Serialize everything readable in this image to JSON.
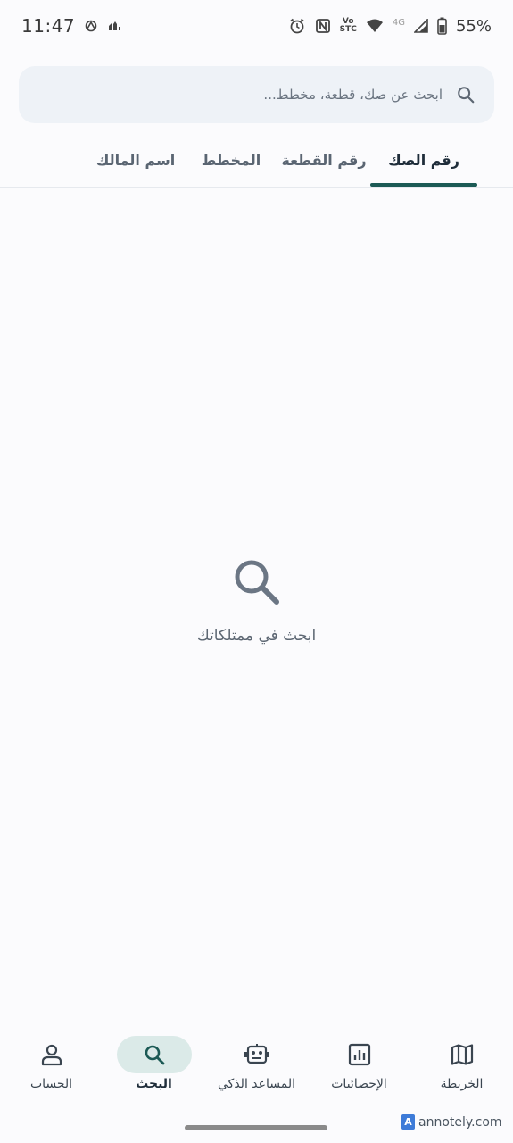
{
  "status_bar": {
    "time": "11:47",
    "battery_percent": "55%",
    "network": "4G",
    "carrier_top": "Vo",
    "carrier_bottom": "STC",
    "icons": [
      "android-auto-icon",
      "app-notification-icon",
      "alarm-icon",
      "nfc-icon",
      "wifi-icon",
      "signal-icon",
      "battery-icon"
    ]
  },
  "search": {
    "placeholder": "ابحث عن صك، قطعة، مخطط...",
    "value": ""
  },
  "tabs": [
    {
      "label": "رقم الصك",
      "active": true
    },
    {
      "label": "رقم القطعة",
      "active": false
    },
    {
      "label": "المخطط",
      "active": false
    },
    {
      "label": "اسم المالك",
      "active": false
    }
  ],
  "empty_state": {
    "message": "ابحث في ممتلكاتك"
  },
  "bottom_nav": [
    {
      "label": "الخريطة",
      "icon": "map-icon",
      "active": false
    },
    {
      "label": "الإحصائيات",
      "icon": "statistics-icon",
      "active": false
    },
    {
      "label": "المساعد الذكي",
      "icon": "robot-icon",
      "active": false
    },
    {
      "label": "البحث",
      "icon": "search-icon",
      "active": true
    },
    {
      "label": "الحساب",
      "icon": "account-icon",
      "active": false
    }
  ],
  "watermark": {
    "logo": "A",
    "text": "annotely.com"
  },
  "colors": {
    "accent": "#1c5a55",
    "active_pill": "#dbeae8",
    "search_bg": "#eef2f7",
    "background": "#fbfbfd"
  }
}
